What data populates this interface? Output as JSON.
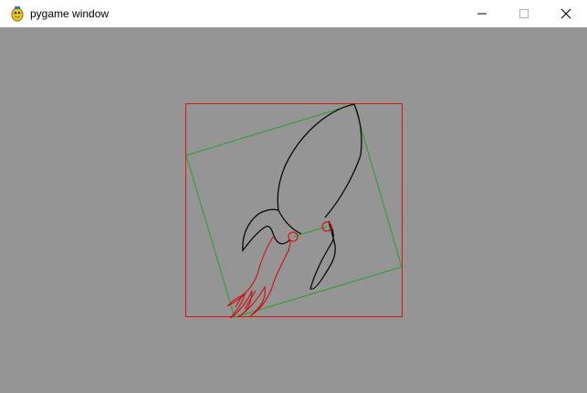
{
  "window": {
    "title": "pygame window",
    "app_icon": "pygame-snake-icon",
    "controls": {
      "minimize_icon": "minimize-icon",
      "maximize_icon": "maximize-icon",
      "close_icon": "close-icon"
    }
  },
  "canvas": {
    "background_color": "#959595",
    "bounding_box_color": "#e01010",
    "rotated_box_color": "#2aa02a",
    "rocket_outline_color": "#000000",
    "flame_color": "#cc1010",
    "marker_color": "#e01010",
    "marker_link_color": "#2aa02a"
  }
}
